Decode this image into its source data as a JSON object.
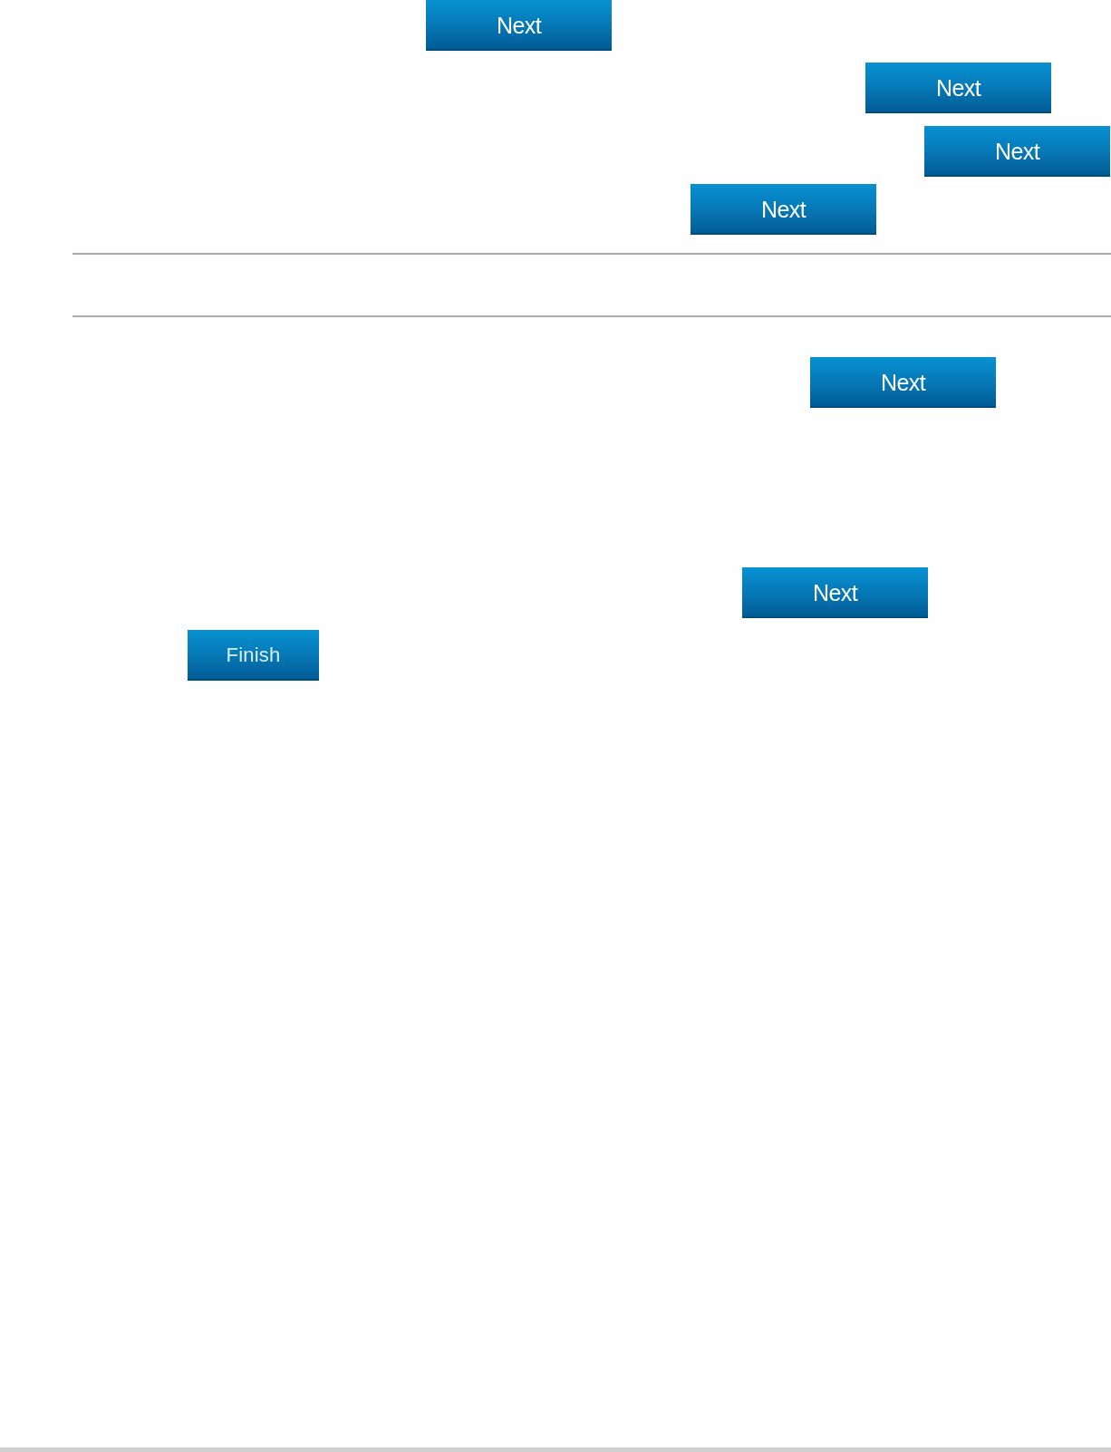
{
  "buttons": [
    {
      "kind": "next",
      "label": "Next"
    },
    {
      "kind": "next",
      "label": "Next"
    },
    {
      "kind": "next",
      "label": "Next"
    },
    {
      "kind": "next",
      "label": "Next"
    },
    {
      "kind": "next",
      "label": "Next"
    },
    {
      "kind": "next",
      "label": "Next"
    },
    {
      "kind": "finish",
      "label": "Finish"
    }
  ]
}
